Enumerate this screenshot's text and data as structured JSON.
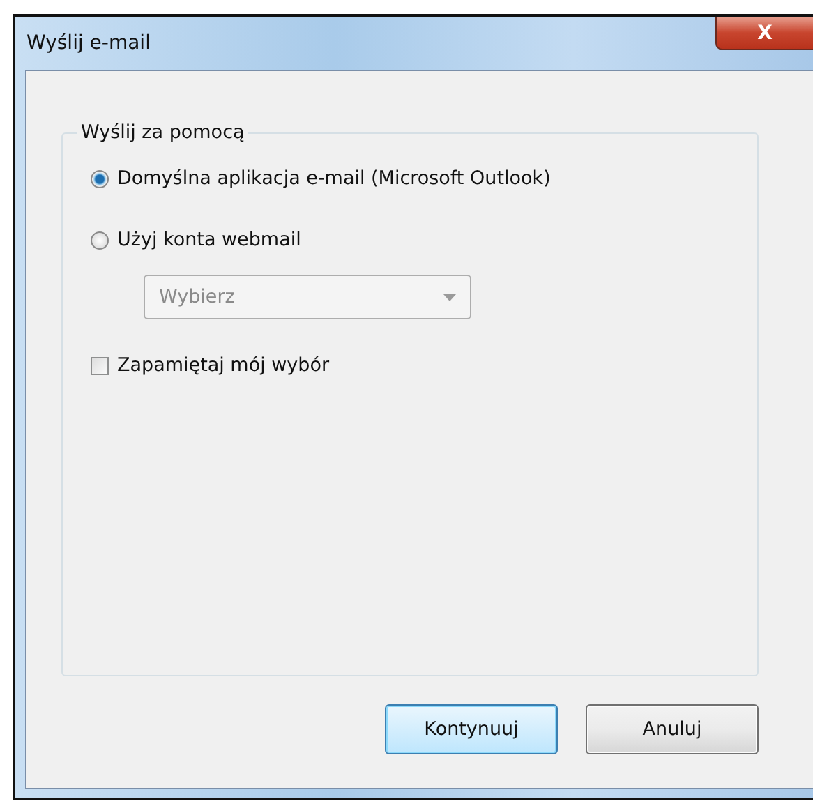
{
  "window": {
    "title": "Wyślij e-mail",
    "close": "X"
  },
  "group": {
    "legend": "Wyślij za pomocą",
    "options": [
      {
        "label": "Domyślna aplikacja e-mail (Microsoft Outlook)",
        "selected": true
      },
      {
        "label": "Użyj konta webmail",
        "selected": false
      }
    ],
    "dropdown": {
      "value": "Wybierz",
      "disabled": true
    },
    "remember": {
      "label": "Zapamiętaj mój wybór",
      "checked": false
    }
  },
  "buttons": [
    {
      "label": "Kontynuuj",
      "default": true
    },
    {
      "label": "Anuluj",
      "default": false
    }
  ]
}
